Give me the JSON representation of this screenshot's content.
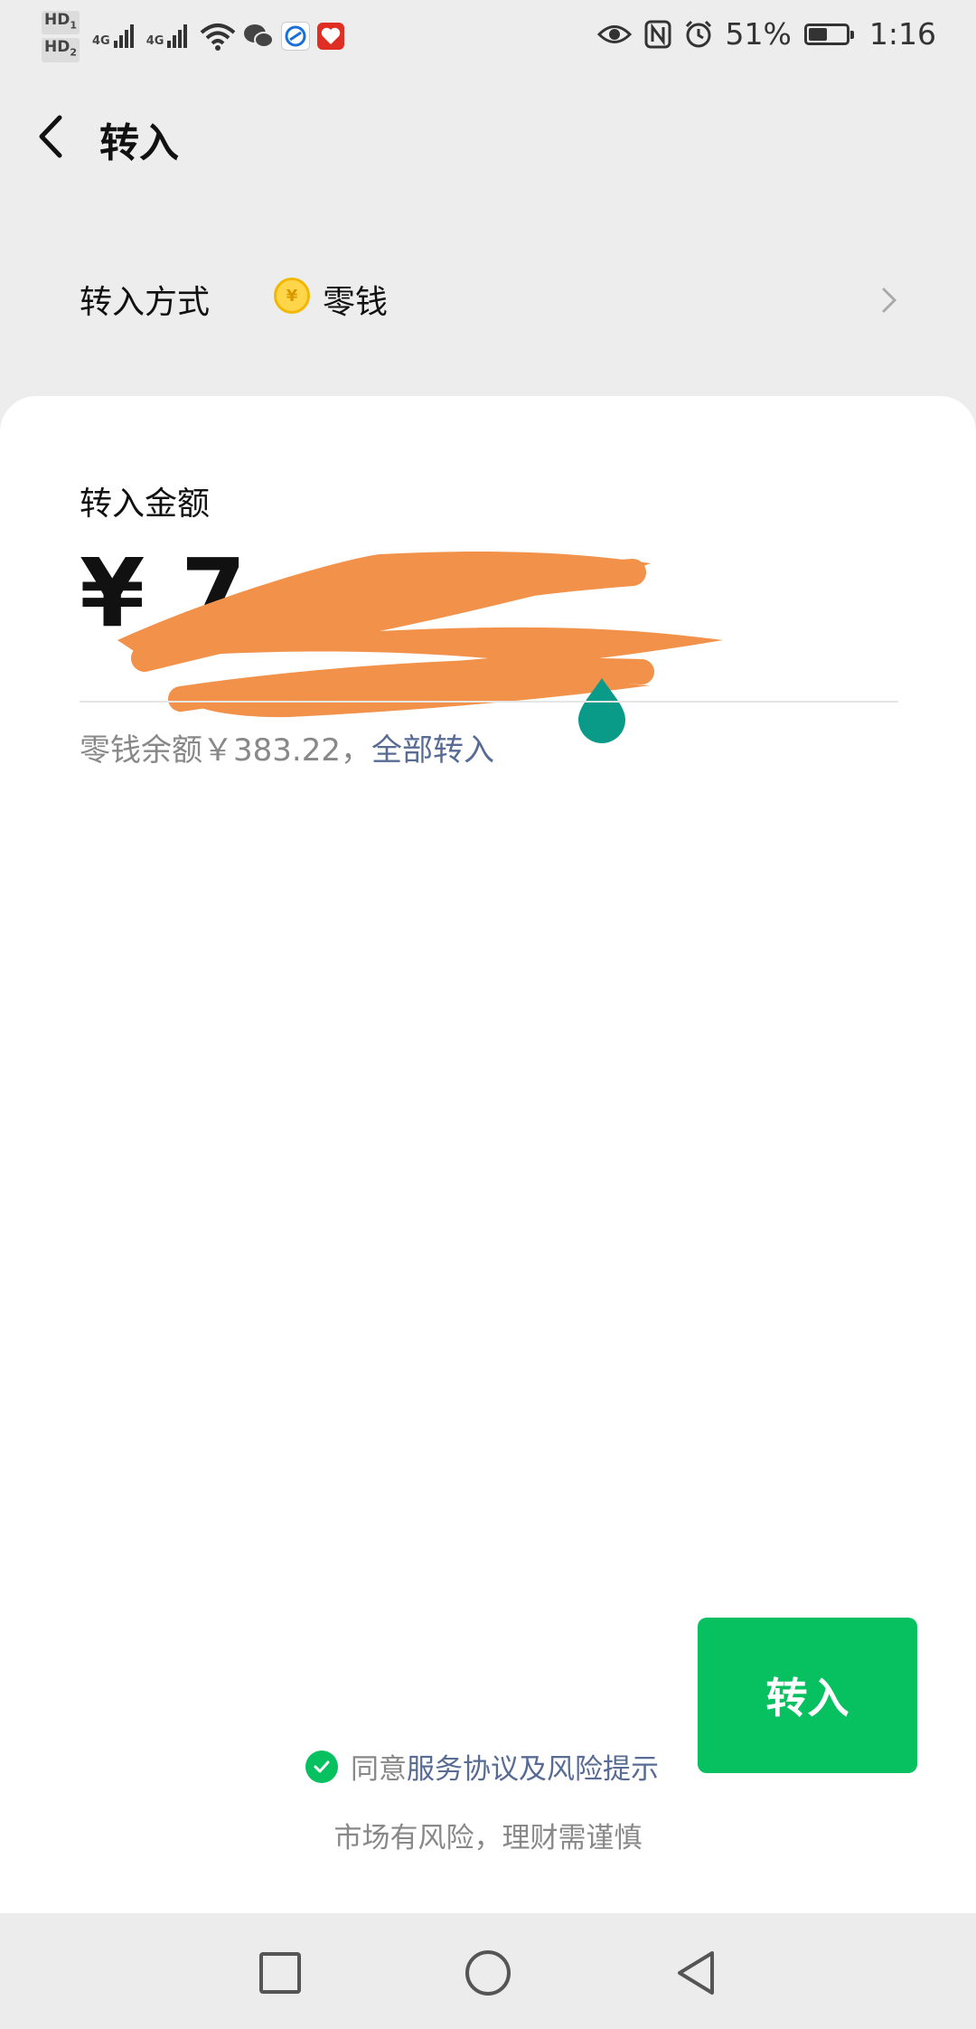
{
  "status_bar": {
    "hd1": "HD",
    "hd1_sub": "1",
    "hd2": "HD",
    "hd2_sub": "2",
    "net1": "4G",
    "net2": "4G",
    "battery_percent": "51%",
    "battery_level": 0.51,
    "time": "1:16"
  },
  "header": {
    "title": "转入"
  },
  "method": {
    "label": "转入方式",
    "value": "零钱",
    "coin_glyph": "¥"
  },
  "amount": {
    "label": "转入金额",
    "currency": "¥",
    "value": "7"
  },
  "balance": {
    "text": "零钱余额￥383.22，",
    "all_link": "全部转入"
  },
  "action": {
    "button_label": "转入"
  },
  "agreement": {
    "prefix": "同意",
    "link": "服务协议及风险提示"
  },
  "risk_note": "市场有风险，理财需谨慎",
  "colors": {
    "primary_green": "#07c160",
    "link_blue": "#576b95",
    "background": "#ededed",
    "redaction_orange": "#f2914a",
    "cursor_teal": "#0a9a88"
  }
}
